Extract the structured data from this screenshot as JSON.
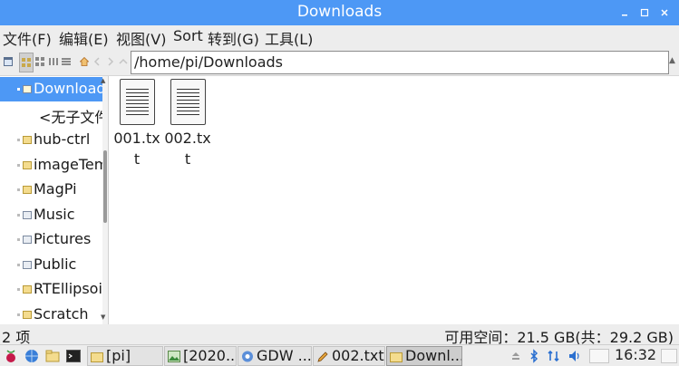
{
  "window": {
    "title": "Downloads",
    "controls": [
      "minimize",
      "maximize",
      "close"
    ]
  },
  "menubar": {
    "items": [
      "文件(F)",
      "编辑(E)",
      "视图(V)",
      "Sort",
      "转到(G)",
      "工具(L)"
    ]
  },
  "toolbar": {
    "address": "/home/pi/Downloads"
  },
  "sidebar": {
    "items": [
      {
        "label": "Downloads",
        "selected": true,
        "icon": "downloads-folder-icon"
      },
      {
        "label": "<无子文件夹>",
        "placeholder": true
      },
      {
        "label": "hub-ctrl",
        "icon": "folder-icon"
      },
      {
        "label": "imageTemplate",
        "icon": "folder-icon"
      },
      {
        "label": "MagPi",
        "icon": "folder-icon"
      },
      {
        "label": "Music",
        "icon": "music-folder-icon"
      },
      {
        "label": "Pictures",
        "icon": "pictures-folder-icon"
      },
      {
        "label": "Public",
        "icon": "public-folder-icon"
      },
      {
        "label": "RTEllipsoid",
        "icon": "folder-icon"
      },
      {
        "label": "Scratch",
        "icon": "folder-icon"
      }
    ]
  },
  "files": [
    {
      "name_line1": "001.tx",
      "name_line2": "t"
    },
    {
      "name_line1": "002.tx",
      "name_line2": "t"
    }
  ],
  "status": {
    "count": "2 项",
    "space": "可用空间：21.5 GB(共：29.2 GB)"
  },
  "taskbar": {
    "tasks": [
      {
        "label": "[pi]",
        "icon": "folder-icon"
      },
      {
        "label": "[2020...",
        "icon": "image-viewer-icon"
      },
      {
        "label": "GDW ...",
        "icon": "chromium-icon"
      },
      {
        "label": "002.txt",
        "icon": "text-editor-icon"
      },
      {
        "label": "Downl...",
        "icon": "folder-icon",
        "active": true
      }
    ],
    "clock": "16:32"
  },
  "colors": {
    "accent": "#4d98f5",
    "chrome": "#ededed",
    "folder": "#f4dc8e"
  }
}
